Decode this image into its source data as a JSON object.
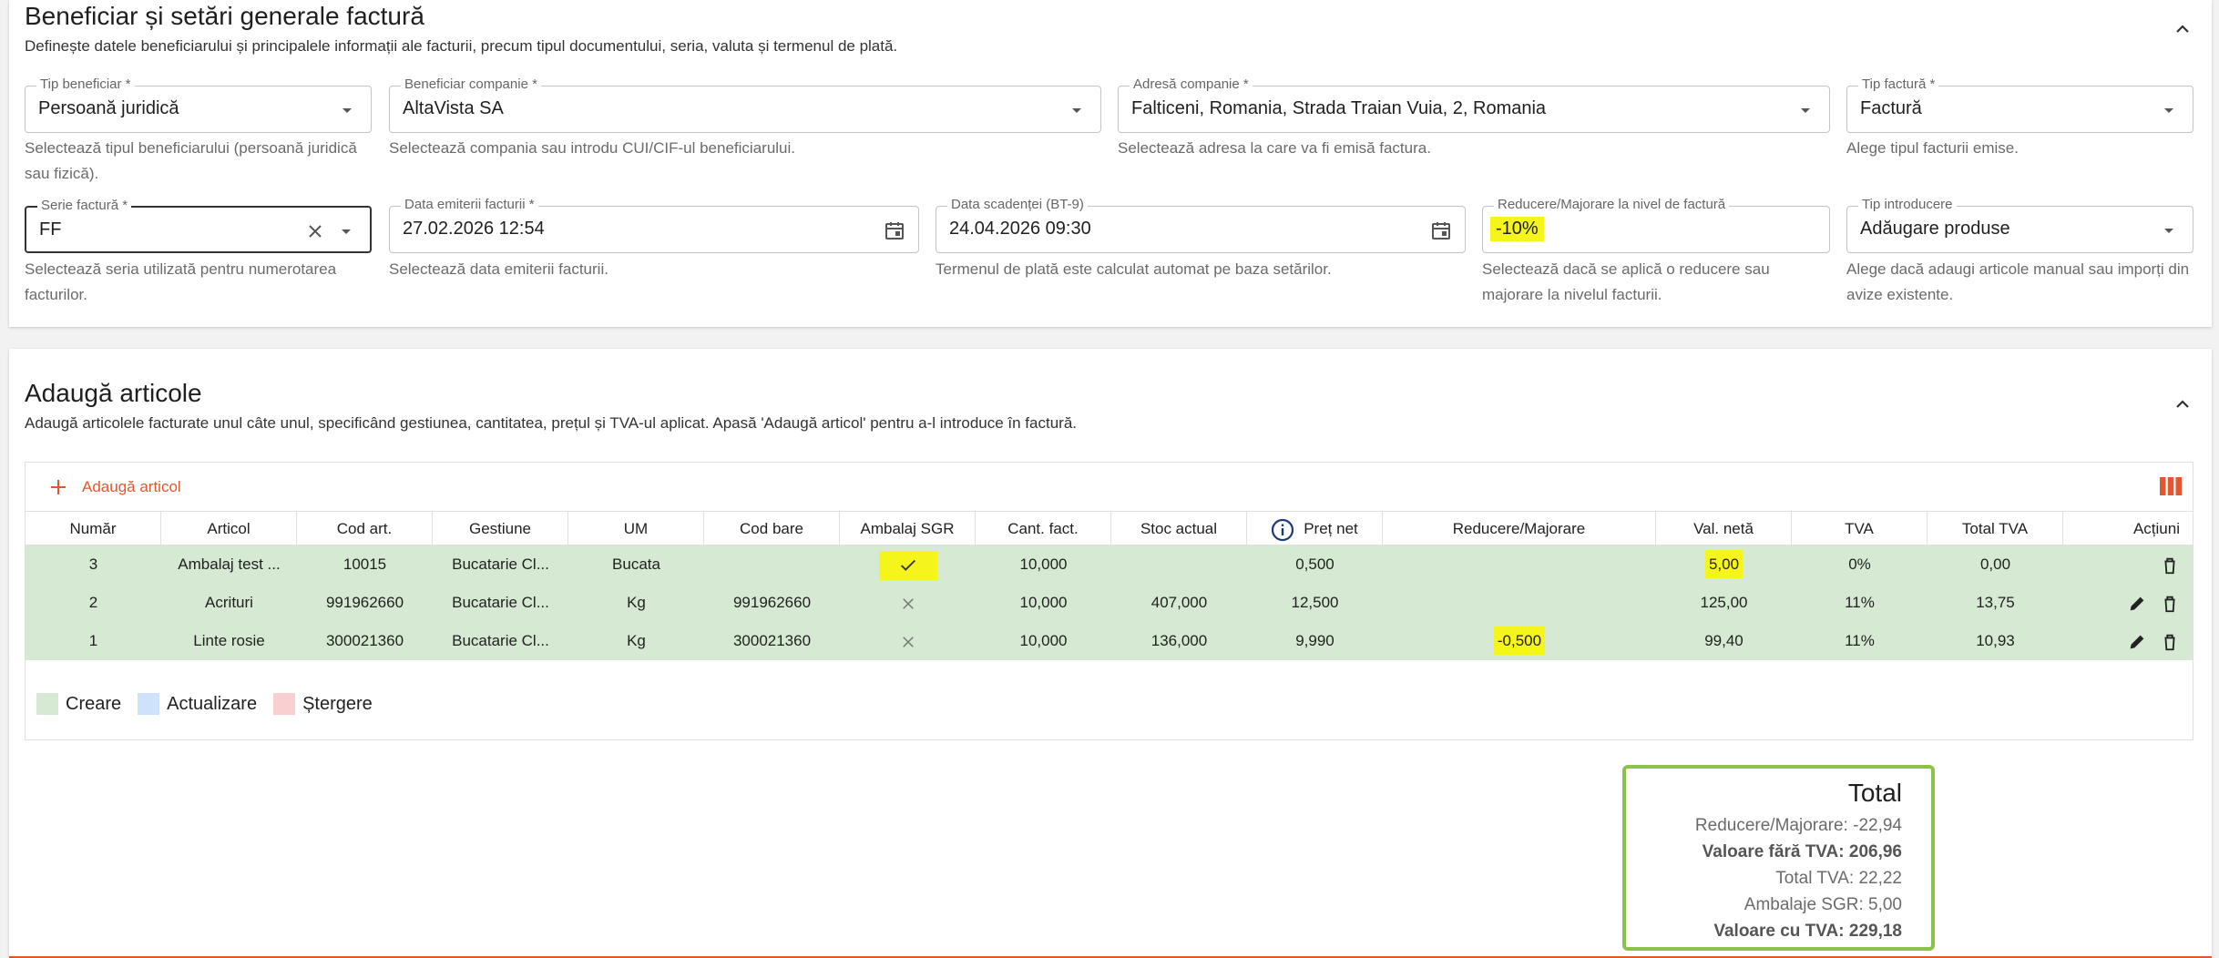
{
  "section1": {
    "title": "Beneficiar și setări generale factură",
    "subtitle": "Definește datele beneficiarului și principalele informații ale facturii, precum tipul documentului, seria, valuta și termenul de plată.",
    "fields": {
      "tip_beneficiar": {
        "label": "Tip beneficiar *",
        "value": "Persoană juridică",
        "help": "Selectează tipul beneficiarului (persoană juridică sau fizică)."
      },
      "beneficiar_companie": {
        "label": "Beneficiar companie *",
        "value": "AltaVista SA",
        "help": "Selectează compania sau introdu CUI/CIF-ul beneficiarului."
      },
      "adresa_companie": {
        "label": "Adresă companie *",
        "value": "Falticeni, Romania, Strada Traian Vuia, 2, Romania",
        "help": "Selectează adresa la care va fi emisă factura."
      },
      "tip_factura": {
        "label": "Tip factură *",
        "value": "Factură",
        "help": "Alege tipul facturii emise."
      },
      "serie_factura": {
        "label": "Serie factură *",
        "value": "FF",
        "help": "Selectează seria utilizată pentru numerotarea facturilor."
      },
      "data_emiterii": {
        "label": "Data emiterii facturii *",
        "value": "27.02.2026 12:54",
        "help": "Selectează data emiterii facturii."
      },
      "data_scadentei": {
        "label": "Data scadenței (BT-9)",
        "value": "24.04.2026 09:30",
        "help": "Termenul de plată este calculat automat pe baza setărilor."
      },
      "reducere": {
        "label": "Reducere/Majorare la nivel de factură",
        "value": "-10%",
        "help": "Selectează dacă se aplică o reducere sau majorare la nivelul facturii."
      },
      "tip_introducere": {
        "label": "Tip introducere",
        "value": "Adăugare produse",
        "help": "Alege dacă adaugi articole manual sau imporți din avize existente."
      }
    }
  },
  "section2": {
    "title": "Adaugă articole",
    "subtitle": "Adaugă articolele facturate unul câte unul, specificând gestiunea, cantitatea, prețul și TVA-ul aplicat. Apasă 'Adaugă articol' pentru a-l introduce în factură.",
    "add_button": "Adaugă articol",
    "columns": [
      "Număr",
      "Articol",
      "Cod art.",
      "Gestiune",
      "UM",
      "Cod bare",
      "Ambalaj SGR",
      "Cant. fact.",
      "Stoc actual",
      "Preț net",
      "Reducere/Majorare",
      "Val. netă",
      "TVA",
      "Total TVA",
      "Acțiuni"
    ],
    "rows": [
      {
        "numar": "3",
        "articol": "Ambalaj test ...",
        "cod_art": "10015",
        "gestiune": "Bucatarie Cl...",
        "um": "Bucata",
        "cod_bare": "",
        "sgr": true,
        "cant": "10,000",
        "stoc": "",
        "pret": "0,500",
        "reducere": "",
        "val_neta": "5,00",
        "tva": "0%",
        "total_tva": "0,00",
        "editable": false
      },
      {
        "numar": "2",
        "articol": "Acrituri",
        "cod_art": "991962660",
        "gestiune": "Bucatarie Cl...",
        "um": "Kg",
        "cod_bare": "991962660",
        "sgr": false,
        "cant": "10,000",
        "stoc": "407,000",
        "pret": "12,500",
        "reducere": "",
        "val_neta": "125,00",
        "tva": "11%",
        "total_tva": "13,75",
        "editable": true
      },
      {
        "numar": "1",
        "articol": "Linte rosie",
        "cod_art": "300021360",
        "gestiune": "Bucatarie Cl...",
        "um": "Kg",
        "cod_bare": "300021360",
        "sgr": false,
        "cant": "10,000",
        "stoc": "136,000",
        "pret": "9,990",
        "reducere": "-0,500",
        "val_neta": "99,40",
        "tva": "11%",
        "total_tva": "10,93",
        "editable": true
      }
    ],
    "legend": [
      {
        "label": "Creare",
        "color": "#d6e9d3"
      },
      {
        "label": "Actualizare",
        "color": "#cfe2fb"
      },
      {
        "label": "Ștergere",
        "color": "#f9cfcf"
      }
    ]
  },
  "totals": {
    "title": "Total",
    "reducere": "Reducere/Majorare: -22,94",
    "fara_tva": "Valoare fără TVA: 206,96",
    "total_tva": "Total TVA: 22,22",
    "sgr": "Ambalaje SGR: 5,00",
    "cu_tva": "Valoare cu TVA: 229,18"
  },
  "colors": {
    "accent": "#e4572e",
    "row_created": "#d6e9d3",
    "highlight": "#f5f51c",
    "totals_border": "#8bc34a"
  }
}
